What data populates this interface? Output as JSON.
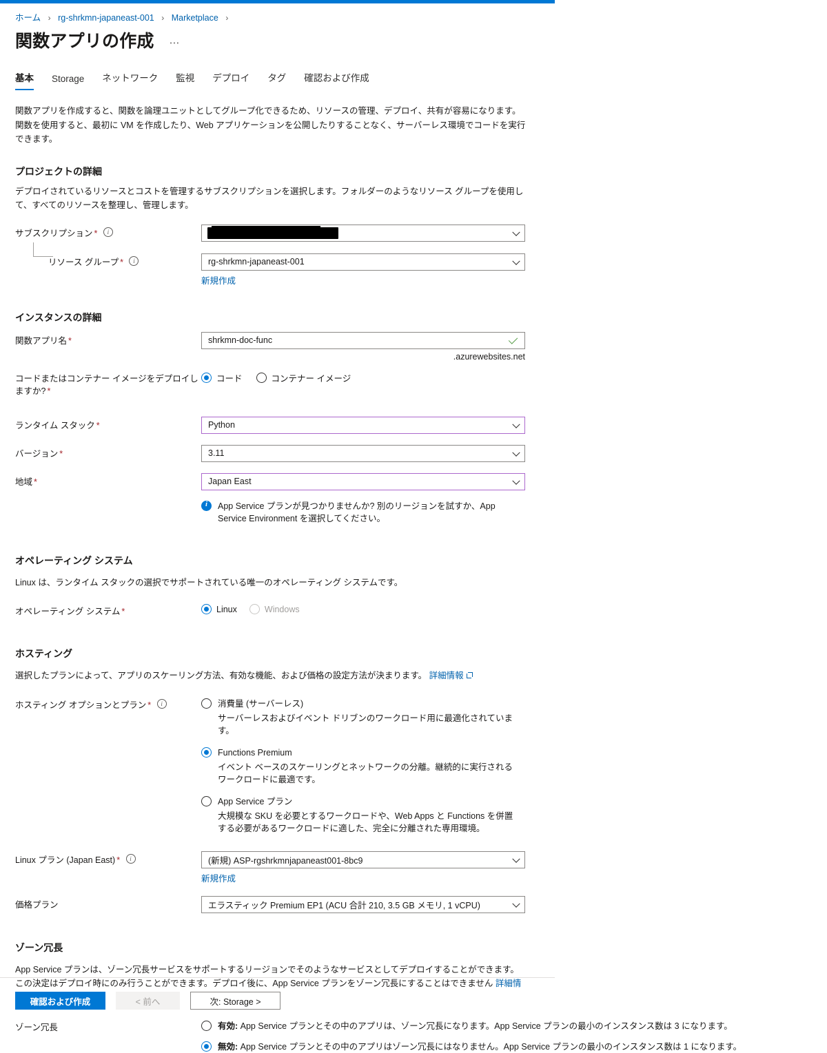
{
  "accent": "#0078d4",
  "breadcrumb": {
    "items": [
      "ホーム",
      "rg-shrkmn-japaneast-001",
      "Marketplace"
    ],
    "separator": "›"
  },
  "header": {
    "title": "関数アプリの作成",
    "more_label": "⋯"
  },
  "tabs": [
    {
      "label": "基本",
      "active": true
    },
    {
      "label": "Storage",
      "active": false
    },
    {
      "label": "ネットワーク",
      "active": false
    },
    {
      "label": "監視",
      "active": false
    },
    {
      "label": "デプロイ",
      "active": false
    },
    {
      "label": "タグ",
      "active": false
    },
    {
      "label": "確認および作成",
      "active": false
    }
  ],
  "intro": "関数アプリを作成すると、関数を論理ユニットとしてグループ化できるため、リソースの管理、デプロイ、共有が容易になります。関数を使用すると、最初に VM を作成したり、Web アプリケーションを公開したりすることなく、サーバーレス環境でコードを実行できます。",
  "project": {
    "heading": "プロジェクトの詳細",
    "description": "デプロイされているリソースとコストを管理するサブスクリプションを選択します。フォルダーのようなリソース グループを使用して、すべてのリソースを整理し、管理します。",
    "subscription": {
      "label": "サブスクリプション",
      "required": "*",
      "value": "",
      "redacted": true
    },
    "resource_group": {
      "label": "リソース グループ",
      "required": "*",
      "value": "rg-shrkmn-japaneast-001",
      "create_new": "新規作成"
    }
  },
  "instance": {
    "heading": "インスタンスの詳細",
    "app_name": {
      "label": "関数アプリ名",
      "required": "*",
      "value": "shrkmn-doc-func",
      "suffix": ".azurewebsites.net",
      "valid": true
    },
    "deploy_type": {
      "label": "コードまたはコンテナー イメージをデプロイしますか?",
      "required": "*",
      "options": [
        {
          "label": "コード",
          "selected": true
        },
        {
          "label": "コンテナー イメージ",
          "selected": false
        }
      ]
    },
    "runtime_stack": {
      "label": "ランタイム スタック",
      "required": "*",
      "value": "Python"
    },
    "version": {
      "label": "バージョン",
      "required": "*",
      "value": "3.11"
    },
    "region": {
      "label": "地域",
      "required": "*",
      "value": "Japan East"
    },
    "region_info": "App Service プランが見つかりませんか? 別のリージョンを試すか、App Service Environment を選択してください。"
  },
  "operating_system": {
    "heading": "オペレーティング システム",
    "description": "Linux は、ランタイム スタックの選択でサポートされている唯一のオペレーティング システムです。",
    "field_label": "オペレーティング システム",
    "required": "*",
    "options": [
      {
        "label": "Linux",
        "selected": true,
        "disabled": false
      },
      {
        "label": "Windows",
        "selected": false,
        "disabled": true
      }
    ]
  },
  "hosting": {
    "heading": "ホスティング",
    "description": "選択したプランによって、アプリのスケーリング方法、有効な機能、および価格の設定方法が決まります。",
    "learn_more": "詳細情報",
    "plan_label": "ホスティング オプションとプラン",
    "required": "*",
    "options": [
      {
        "title": "消費量 (サーバーレス)",
        "desc": "サーバーレスおよびイベント ドリブンのワークロード用に最適化されています。",
        "selected": false
      },
      {
        "title": "Functions Premium",
        "desc": "イベント ベースのスケーリングとネットワークの分離。継続的に実行されるワークロードに最適です。",
        "selected": true
      },
      {
        "title": "App Service プラン",
        "desc": "大規模な SKU を必要とするワークロードや、Web Apps と Functions を併置する必要があるワークロードに適した、完全に分離された専用環境。",
        "selected": false
      }
    ],
    "linux_plan": {
      "label": "Linux プラン (Japan East)",
      "required": "*",
      "value": "(新規) ASP-rgshrkmnjapaneast001-8bc9",
      "create_new": "新規作成"
    },
    "pricing_plan": {
      "label": "価格プラン",
      "value": "エラスティック Premium EP1 (ACU 合計 210, 3.5 GB メモリ, 1 vCPU)"
    }
  },
  "zone_redundancy": {
    "heading": "ゾーン冗長",
    "description": "App Service プランは、ゾーン冗長サービスをサポートするリージョンでそのようなサービスとしてデプロイすることができます。この決定はデプロイ時にのみ行うことができます。デプロイ後に、App Service プランをゾーン冗長にすることはできません",
    "learn_more": "詳細情報",
    "field_label": "ゾーン冗長",
    "options": [
      {
        "bold": "有効:",
        "text": " App Service プランとその中のアプリは、ゾーン冗長になります。App Service プランの最小のインスタンス数は 3 になります。",
        "selected": false
      },
      {
        "bold": "無効:",
        "text": " App Service プランとその中のアプリはゾーン冗長にはなりません。App Service プランの最小のインスタンス数は 1 になります。",
        "selected": true
      }
    ]
  },
  "footer": {
    "review_create": "確認および作成",
    "previous": "< 前へ",
    "next": "次: Storage >"
  }
}
